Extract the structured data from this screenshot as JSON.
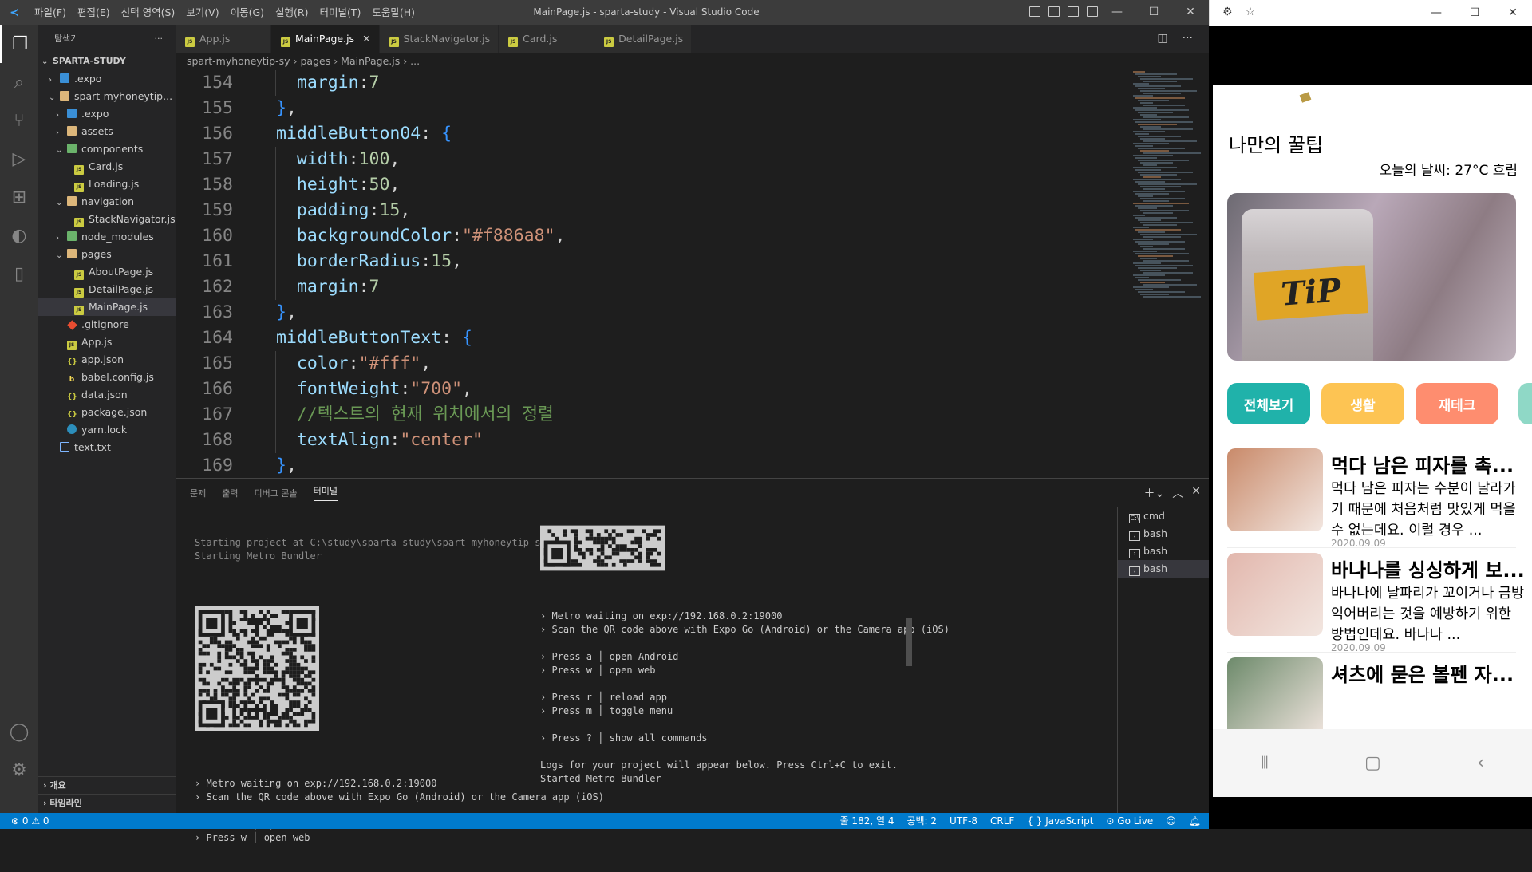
{
  "titlebar": {
    "app_title": "MainPage.js - sparta-study - Visual Studio Code",
    "menu": [
      "파일(F)",
      "편집(E)",
      "선택 영역(S)",
      "보기(V)",
      "이동(G)",
      "실행(R)",
      "터미널(T)",
      "도움말(H)"
    ]
  },
  "sidebar": {
    "header": "탐색기",
    "root": "SPARTA-STUDY",
    "tree": [
      {
        "label": ".expo",
        "indent": 1,
        "chev": "›",
        "icon": "expo"
      },
      {
        "label": "spart-myhoneytip...",
        "indent": 1,
        "chev": "⌄",
        "icon": "folder"
      },
      {
        "label": ".expo",
        "indent": 2,
        "chev": "›",
        "icon": "expo"
      },
      {
        "label": "assets",
        "indent": 2,
        "chev": "›",
        "icon": "folder"
      },
      {
        "label": "components",
        "indent": 2,
        "chev": "⌄",
        "icon": "foldersrc"
      },
      {
        "label": "Card.js",
        "indent": 3,
        "chev": "",
        "icon": "js"
      },
      {
        "label": "Loading.js",
        "indent": 3,
        "chev": "",
        "icon": "js"
      },
      {
        "label": "navigation",
        "indent": 2,
        "chev": "⌄",
        "icon": "folder"
      },
      {
        "label": "StackNavigator.js",
        "indent": 3,
        "chev": "",
        "icon": "js"
      },
      {
        "label": "node_modules",
        "indent": 2,
        "chev": "›",
        "icon": "foldersrc"
      },
      {
        "label": "pages",
        "indent": 2,
        "chev": "⌄",
        "icon": "folder"
      },
      {
        "label": "AboutPage.js",
        "indent": 3,
        "chev": "",
        "icon": "js"
      },
      {
        "label": "DetailPage.js",
        "indent": 3,
        "chev": "",
        "icon": "js"
      },
      {
        "label": "MainPage.js",
        "indent": 3,
        "chev": "",
        "icon": "js",
        "selected": true
      },
      {
        "label": ".gitignore",
        "indent": 2,
        "chev": "",
        "icon": "git"
      },
      {
        "label": "App.js",
        "indent": 2,
        "chev": "",
        "icon": "js"
      },
      {
        "label": "app.json",
        "indent": 2,
        "chev": "",
        "icon": "json"
      },
      {
        "label": "babel.config.js",
        "indent": 2,
        "chev": "",
        "icon": "babel"
      },
      {
        "label": "data.json",
        "indent": 2,
        "chev": "",
        "icon": "json"
      },
      {
        "label": "package.json",
        "indent": 2,
        "chev": "",
        "icon": "json"
      },
      {
        "label": "yarn.lock",
        "indent": 2,
        "chev": "",
        "icon": "yarn"
      },
      {
        "label": "text.txt",
        "indent": 1,
        "chev": "",
        "icon": "txt"
      }
    ],
    "outline": "개요",
    "timeline": "타임라인"
  },
  "tabs": [
    {
      "label": "App.js",
      "active": false
    },
    {
      "label": "MainPage.js",
      "active": true
    },
    {
      "label": "StackNavigator.js",
      "active": false
    },
    {
      "label": "Card.js",
      "active": false
    },
    {
      "label": "DetailPage.js",
      "active": false
    }
  ],
  "breadcrumb": "spart-myhoneytip-sy  ›  pages  ›  MainPage.js  ›  ...",
  "code_lines": [
    {
      "n": "154",
      "html": "<span class='key'>margin</span><span class='pun'>:</span><span class='num'>7</span>",
      "indent": 2
    },
    {
      "n": "155",
      "html": "<span class='brk'>}</span><span class='pun'>,</span>",
      "indent": 1
    },
    {
      "n": "156",
      "html": "<span class='obj'>middleButton04</span><span class='pun'>: </span><span class='brk'>{</span>",
      "indent": 1
    },
    {
      "n": "157",
      "html": "<span class='key'>width</span><span class='pun'>:</span><span class='num'>100</span><span class='pun'>,</span>",
      "indent": 2
    },
    {
      "n": "158",
      "html": "<span class='key'>height</span><span class='pun'>:</span><span class='num'>50</span><span class='pun'>,</span>",
      "indent": 2
    },
    {
      "n": "159",
      "html": "<span class='key'>padding</span><span class='pun'>:</span><span class='num'>15</span><span class='pun'>,</span>",
      "indent": 2
    },
    {
      "n": "160",
      "html": "<span class='key'>backgroundColor</span><span class='pun'>:</span><span class='str'>\"#f886a8\"</span><span class='pun'>,</span>",
      "indent": 2
    },
    {
      "n": "161",
      "html": "<span class='key'>borderRadius</span><span class='pun'>:</span><span class='num'>15</span><span class='pun'>,</span>",
      "indent": 2
    },
    {
      "n": "162",
      "html": "<span class='key'>margin</span><span class='pun'>:</span><span class='num'>7</span>",
      "indent": 2
    },
    {
      "n": "163",
      "html": "<span class='brk'>}</span><span class='pun'>,</span>",
      "indent": 1
    },
    {
      "n": "164",
      "html": "<span class='obj'>middleButtonText</span><span class='pun'>: </span><span class='brk'>{</span>",
      "indent": 1
    },
    {
      "n": "165",
      "html": "<span class='key'>color</span><span class='pun'>:</span><span class='str'>\"#fff\"</span><span class='pun'>,</span>",
      "indent": 2
    },
    {
      "n": "166",
      "html": "<span class='key'>fontWeight</span><span class='pun'>:</span><span class='str'>\"700\"</span><span class='pun'>,</span>",
      "indent": 2
    },
    {
      "n": "167",
      "html": "<span class='cmt'>//텍스트의 현재 위치에서의 정렬</span>",
      "indent": 2
    },
    {
      "n": "168",
      "html": "<span class='key'>textAlign</span><span class='pun'>:</span><span class='str'>\"center\"</span>",
      "indent": 2
    },
    {
      "n": "169",
      "html": "<span class='brk'>}</span><span class='pun'>,</span>",
      "indent": 1
    }
  ],
  "panel": {
    "tabs": [
      "문제",
      "출력",
      "디버그 콘솔",
      "터미널"
    ],
    "active_tab": "터미널",
    "term_left_top": [
      "Starting project at C:\\study\\sparta-study\\spart-myhoneytip-sy",
      "Starting Metro Bundler"
    ],
    "term_left_bottom": [
      "› Metro waiting on exp://192.168.0.2:19000",
      "› Scan the QR code above with Expo Go (Android) or the Camera app (iOS)",
      "",
      "› Press a │ open Android",
      "› Press w │ open web"
    ],
    "term_right": [
      "› Metro waiting on exp://192.168.0.2:19000",
      "› Scan the QR code above with Expo Go (Android) or the Camera app (iOS)",
      "",
      "› Press a │ open Android",
      "› Press w │ open web",
      "",
      "› Press r │ reload app",
      "› Press m │ toggle menu",
      "",
      "› Press ? │ show all commands",
      "",
      "Logs for your project will appear below. Press Ctrl+C to exit.",
      "Started Metro Bundler"
    ],
    "terminals": [
      {
        "label": "cmd",
        "icon": "C:\\",
        "selected": false
      },
      {
        "label": "bash",
        "icon": "›",
        "selected": false
      },
      {
        "label": "bash",
        "icon": "›",
        "selected": false
      },
      {
        "label": "bash",
        "icon": "›",
        "selected": true
      }
    ]
  },
  "status": {
    "errors": "⊗ 0 ⚠ 0",
    "position": "줄 182, 열 4",
    "spaces": "공백: 2",
    "encoding": "UTF-8",
    "eol": "CRLF",
    "language": "{ } JavaScript",
    "golive": "Go Live"
  },
  "phone": {
    "title": "나만의 꿀팁",
    "weather": "오늘의 날씨: 27°C 흐림",
    "hero_text": "TiP",
    "categories": [
      {
        "label": "전체보기",
        "color": "#20b2aa"
      },
      {
        "label": "생활",
        "color": "#fdc453"
      },
      {
        "label": "재테크",
        "color": "#fe8d6f"
      }
    ],
    "cards": [
      {
        "title": "먹다 남은 피자를 촉...",
        "desc": "먹다 남은 피자는 수분이 날라가기 때문에 처음처럼 맛있게 먹을 수 없는데요. 이럴 경우 ...",
        "date": "2020.09.09",
        "color": "#c98a6a"
      },
      {
        "title": "바나나를 싱싱하게 보...",
        "desc": "바나나에 날파리가 꼬이거나 금방 익어버리는 것을 예방하기 위한 방법인데요. 바나나 ...",
        "date": "2020.09.09",
        "color": "#e2b7ad"
      },
      {
        "title": "셔츠에 묻은 볼펜 자...",
        "desc": "",
        "date": "",
        "color": "#6d8a6b"
      }
    ]
  }
}
